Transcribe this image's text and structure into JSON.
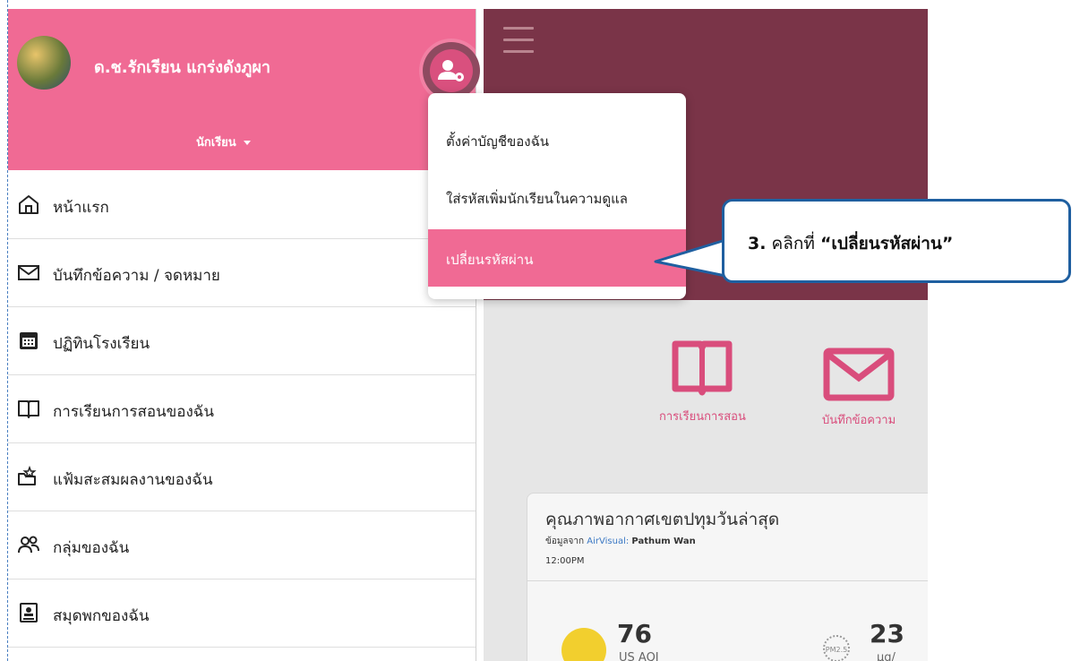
{
  "sidebar": {
    "user_name": "ด.ช.รักเรียน แกร่งดังภูผา",
    "role": "นักเรียน",
    "items": [
      {
        "label": "หน้าแรก",
        "icon": "home-icon"
      },
      {
        "label": "บันทึกข้อความ / จดหมาย",
        "icon": "envelope-icon"
      },
      {
        "label": "ปฏิทินโรงเรียน",
        "icon": "calendar-icon"
      },
      {
        "label": "การเรียนการสอนของฉัน",
        "icon": "book-icon"
      },
      {
        "label": "แฟ้มสะสมผลงานของฉัน",
        "icon": "portfolio-icon"
      },
      {
        "label": "กลุ่มของฉัน",
        "icon": "group-icon"
      },
      {
        "label": "สมุดพกของฉัน",
        "icon": "contact-book-icon"
      }
    ]
  },
  "dropdown": {
    "items": [
      {
        "label": "ตั้งค่าบัญชีของฉัน",
        "active": false
      },
      {
        "label": "ใส่รหัสเพิ่มนักเรียนในความดูแล",
        "active": false
      },
      {
        "label": "เปลี่ยนรหัสผ่าน",
        "active": true
      }
    ]
  },
  "callout": {
    "step": "3.",
    "text": "คลิกที่",
    "target": "“เปลี่ยนรหัสผ่าน”"
  },
  "main": {
    "tiles": [
      {
        "label": "การเรียนการสอน",
        "icon": "book-icon"
      },
      {
        "label": "บันทึกข้อความ",
        "icon": "envelope-icon"
      }
    ],
    "air_quality": {
      "title": "คุณภาพอากาศเขตปทุมวันล่าสุด",
      "source_prefix": "ข้อมูลจาก",
      "source_link": "AirVisual:",
      "location": "Pathum Wan",
      "time": "12:00PM",
      "aqi_value": "76",
      "aqi_unit": "US AQI",
      "pm_label": "PM2.5",
      "pm_value": "23",
      "pm_unit": "µg/"
    }
  },
  "colors": {
    "brand_pink": "#f06a94",
    "overlay_header": "#7a3448",
    "callout_border": "#1f5fa0",
    "tile_pink": "#d94d7c"
  }
}
